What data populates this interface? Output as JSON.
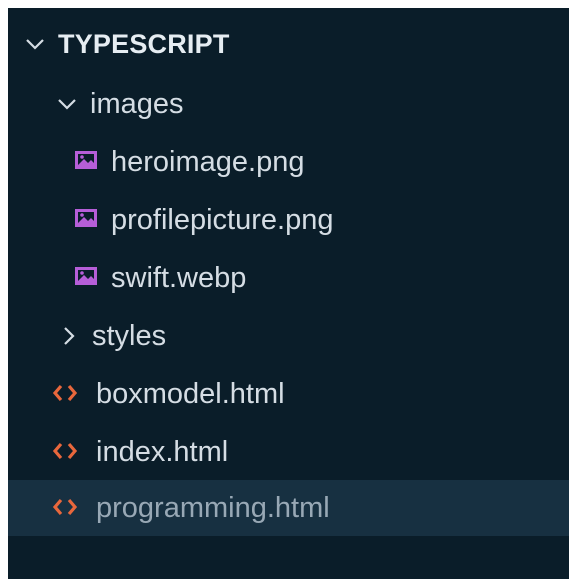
{
  "explorer": {
    "root": {
      "label": "TYPESCRIPT",
      "expanded": true,
      "icon": "chevron-down-icon"
    },
    "items": [
      {
        "label": "images",
        "type": "folder",
        "expanded": true,
        "icon": "chevron-down-icon"
      },
      {
        "label": "heroimage.png",
        "type": "image",
        "icon": "image-file-icon"
      },
      {
        "label": "profilepicture.png",
        "type": "image",
        "icon": "image-file-icon"
      },
      {
        "label": "swift.webp",
        "type": "image",
        "icon": "image-file-icon"
      },
      {
        "label": "styles",
        "type": "folder",
        "expanded": false,
        "icon": "chevron-right-icon"
      },
      {
        "label": "boxmodel.html",
        "type": "html",
        "icon": "html-file-icon"
      },
      {
        "label": "index.html",
        "type": "html",
        "icon": "html-file-icon"
      },
      {
        "label": "programming.html",
        "type": "html",
        "selected": true,
        "icon": "html-file-icon"
      }
    ]
  },
  "colors": {
    "background": "#0a1d29",
    "selected_row": "#173041",
    "text": "#d5dde4",
    "html_icon": "#e8673c",
    "image_icon": "#b65ed8"
  }
}
